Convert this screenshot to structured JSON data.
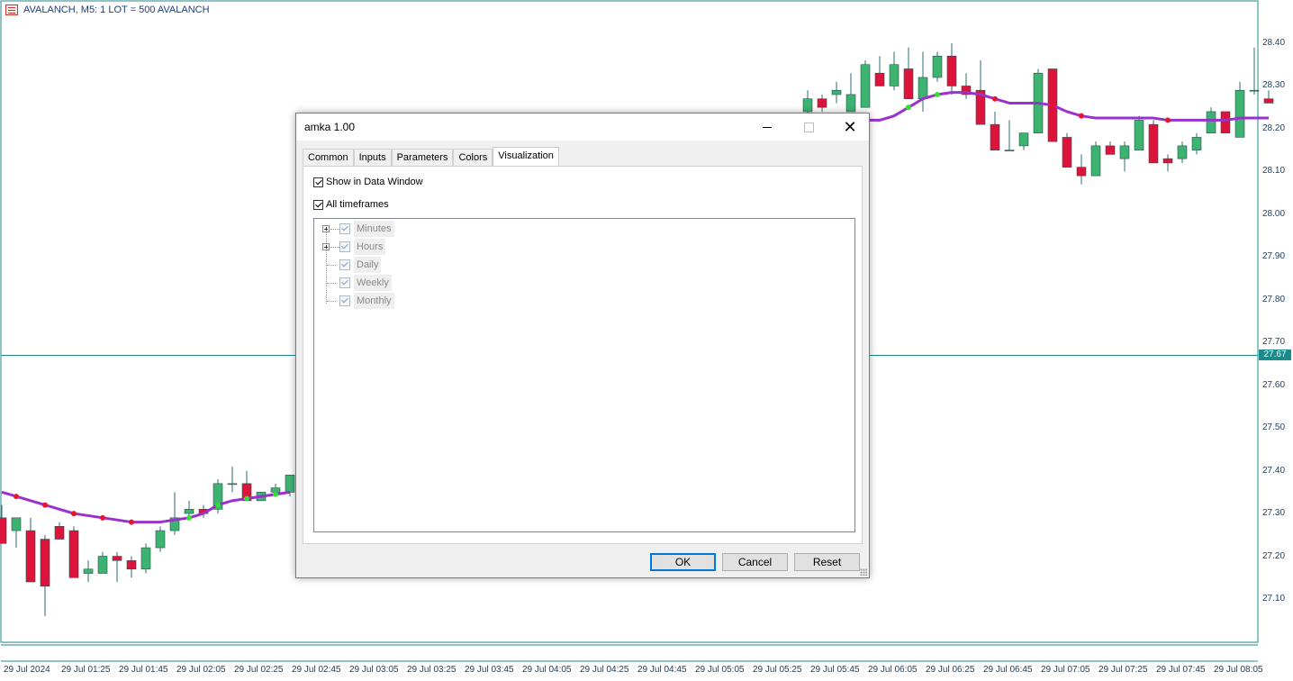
{
  "chart": {
    "title": "AVALANCH, M5:  1 LOT = 500 AVALANCH",
    "price_axis": [
      "28.40",
      "28.30",
      "28.20",
      "28.10",
      "28.00",
      "27.90",
      "27.80",
      "27.70",
      "27.60",
      "27.50",
      "27.40",
      "27.30",
      "27.20",
      "27.10"
    ],
    "hline_price": "27.67",
    "time_axis": [
      "29 Jul 2024",
      "29 Jul 01:25",
      "29 Jul 01:45",
      "29 Jul 02:05",
      "29 Jul 02:25",
      "29 Jul 02:45",
      "29 Jul 03:05",
      "29 Jul 03:25",
      "29 Jul 03:45",
      "29 Jul 04:05",
      "29 Jul 04:25",
      "29 Jul 04:45",
      "29 Jul 05:05",
      "29 Jul 05:25",
      "29 Jul 05:45",
      "29 Jul 06:05",
      "29 Jul 06:25",
      "29 Jul 06:45",
      "29 Jul 07:05",
      "29 Jul 07:25",
      "29 Jul 07:45",
      "29 Jul 08:05"
    ],
    "colors": {
      "bull": "#3cb371",
      "bear": "#dc143c",
      "ma": "#9932cc",
      "axis": "#1c8a8a"
    }
  },
  "chart_data": {
    "type": "candlestick",
    "title": "AVALANCH, M5:  1 LOT = 500 AVALANCH",
    "xlabel": "",
    "ylabel": "",
    "ylim": [
      27.02,
      28.48
    ],
    "visible_left": [
      {
        "o": 27.29,
        "h": 27.32,
        "l": 27.23,
        "c": 27.23
      },
      {
        "o": 27.26,
        "h": 27.28,
        "l": 27.22,
        "c": 27.29
      },
      {
        "o": 27.26,
        "h": 27.29,
        "l": 27.14,
        "c": 27.14
      },
      {
        "o": 27.24,
        "h": 27.25,
        "l": 27.06,
        "c": 27.13
      },
      {
        "o": 27.27,
        "h": 27.28,
        "l": 27.24,
        "c": 27.24
      },
      {
        "o": 27.26,
        "h": 27.27,
        "l": 27.15,
        "c": 27.15
      },
      {
        "o": 27.16,
        "h": 27.19,
        "l": 27.14,
        "c": 27.17
      },
      {
        "o": 27.16,
        "h": 27.21,
        "l": 27.16,
        "c": 27.2
      },
      {
        "o": 27.2,
        "h": 27.21,
        "l": 27.14,
        "c": 27.19
      },
      {
        "o": 27.19,
        "h": 27.2,
        "l": 27.15,
        "c": 27.17
      },
      {
        "o": 27.17,
        "h": 27.23,
        "l": 27.16,
        "c": 27.22
      },
      {
        "o": 27.22,
        "h": 27.27,
        "l": 27.21,
        "c": 27.26
      },
      {
        "o": 27.26,
        "h": 27.35,
        "l": 27.25,
        "c": 27.29
      },
      {
        "o": 27.3,
        "h": 27.33,
        "l": 27.29,
        "c": 27.31
      },
      {
        "o": 27.31,
        "h": 27.32,
        "l": 27.29,
        "c": 27.3
      },
      {
        "o": 27.31,
        "h": 27.38,
        "l": 27.3,
        "c": 27.37
      },
      {
        "o": 27.37,
        "h": 27.41,
        "l": 27.35,
        "c": 27.37
      },
      {
        "o": 27.37,
        "h": 27.4,
        "l": 27.33,
        "c": 27.33
      },
      {
        "o": 27.33,
        "h": 27.35,
        "l": 27.33,
        "c": 27.35
      },
      {
        "o": 27.35,
        "h": 27.37,
        "l": 27.34,
        "c": 27.36
      },
      {
        "o": 27.35,
        "h": 27.39,
        "l": 27.34,
        "c": 27.39
      }
    ],
    "visible_right": [
      {
        "o": 28.24,
        "h": 28.29,
        "l": 28.22,
        "c": 28.27
      },
      {
        "o": 28.27,
        "h": 28.28,
        "l": 28.24,
        "c": 28.25
      },
      {
        "o": 28.28,
        "h": 28.31,
        "l": 28.26,
        "c": 28.29
      },
      {
        "o": 28.24,
        "h": 28.33,
        "l": 28.24,
        "c": 28.28
      },
      {
        "o": 28.25,
        "h": 28.36,
        "l": 28.25,
        "c": 28.35
      },
      {
        "o": 28.33,
        "h": 28.37,
        "l": 28.3,
        "c": 28.3
      },
      {
        "o": 28.3,
        "h": 28.38,
        "l": 28.29,
        "c": 28.35
      },
      {
        "o": 28.34,
        "h": 28.39,
        "l": 28.27,
        "c": 28.27
      },
      {
        "o": 28.27,
        "h": 28.38,
        "l": 28.24,
        "c": 28.32
      },
      {
        "o": 28.32,
        "h": 28.38,
        "l": 28.31,
        "c": 28.37
      },
      {
        "o": 28.37,
        "h": 28.4,
        "l": 28.28,
        "c": 28.3
      },
      {
        "o": 28.3,
        "h": 28.33,
        "l": 28.27,
        "c": 28.28
      },
      {
        "o": 28.29,
        "h": 28.36,
        "l": 28.21,
        "c": 28.21
      },
      {
        "o": 28.21,
        "h": 28.24,
        "l": 28.15,
        "c": 28.15
      },
      {
        "o": 28.15,
        "h": 28.22,
        "l": 28.15,
        "c": 28.15
      },
      {
        "o": 28.16,
        "h": 28.18,
        "l": 28.15,
        "c": 28.19
      },
      {
        "o": 28.19,
        "h": 28.34,
        "l": 28.19,
        "c": 28.33
      },
      {
        "o": 28.34,
        "h": 28.34,
        "l": 28.17,
        "c": 28.17
      },
      {
        "o": 28.18,
        "h": 28.19,
        "l": 28.11,
        "c": 28.11
      },
      {
        "o": 28.11,
        "h": 28.14,
        "l": 28.07,
        "c": 28.09
      },
      {
        "o": 28.09,
        "h": 28.17,
        "l": 28.09,
        "c": 28.16
      },
      {
        "o": 28.16,
        "h": 28.17,
        "l": 28.14,
        "c": 28.14
      },
      {
        "o": 28.13,
        "h": 28.17,
        "l": 28.1,
        "c": 28.16
      },
      {
        "o": 28.15,
        "h": 28.23,
        "l": 28.15,
        "c": 28.22
      },
      {
        "o": 28.21,
        "h": 28.22,
        "l": 28.12,
        "c": 28.12
      },
      {
        "o": 28.13,
        "h": 28.14,
        "l": 28.1,
        "c": 28.12
      },
      {
        "o": 28.13,
        "h": 28.17,
        "l": 28.12,
        "c": 28.16
      },
      {
        "o": 28.15,
        "h": 28.19,
        "l": 28.14,
        "c": 28.18
      },
      {
        "o": 28.19,
        "h": 28.25,
        "l": 28.19,
        "c": 28.24
      },
      {
        "o": 28.24,
        "h": 28.24,
        "l": 28.19,
        "c": 28.19
      },
      {
        "o": 28.18,
        "h": 28.31,
        "l": 28.18,
        "c": 28.29
      },
      {
        "o": 28.29,
        "h": 28.39,
        "l": 28.28,
        "c": 28.29
      },
      {
        "o": 28.27,
        "h": 28.29,
        "l": 28.26,
        "c": 28.26
      }
    ],
    "ma_left": [
      27.35,
      27.34,
      27.33,
      27.32,
      27.31,
      27.3,
      27.295,
      27.29,
      27.285,
      27.28,
      27.28,
      27.28,
      27.285,
      27.29,
      27.3,
      27.32,
      27.33,
      27.335,
      27.34,
      27.345,
      27.35
    ],
    "ma_right": [
      28.2,
      28.2,
      28.21,
      28.22,
      28.22,
      28.22,
      28.23,
      28.25,
      28.27,
      28.28,
      28.285,
      28.285,
      28.28,
      28.27,
      28.26,
      28.26,
      28.26,
      28.255,
      28.24,
      28.23,
      28.225,
      28.225,
      28.225,
      28.225,
      28.225,
      28.22,
      28.22,
      28.22,
      28.22,
      28.22,
      28.225,
      28.225,
      28.225
    ]
  },
  "dialog": {
    "title": "amka 1.00",
    "tabs": [
      "Common",
      "Inputs",
      "Parameters",
      "Colors",
      "Visualization"
    ],
    "show_data_window": "Show in Data Window",
    "all_timeframes": "All timeframes",
    "tree": [
      "Minutes",
      "Hours",
      "Daily",
      "Weekly",
      "Monthly"
    ],
    "buttons": {
      "ok": "OK",
      "cancel": "Cancel",
      "reset": "Reset"
    }
  }
}
